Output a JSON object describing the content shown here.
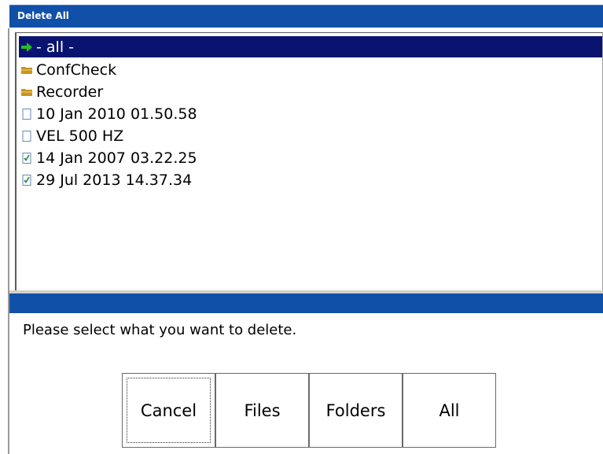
{
  "window": {
    "title": "Delete All"
  },
  "list": {
    "items": [
      {
        "label": "- all -",
        "icon": "green-arrow-icon",
        "selected": true
      },
      {
        "label": "ConfCheck",
        "icon": "folder-icon",
        "selected": false
      },
      {
        "label": "Recorder",
        "icon": "folder-icon",
        "selected": false
      },
      {
        "label": "10 Jan 2010 01.50.58",
        "icon": "file-icon",
        "selected": false
      },
      {
        "label": "VEL 500 HZ",
        "icon": "file-icon",
        "selected": false
      },
      {
        "label": "14 Jan 2007 03.22.25",
        "icon": "checked-file-icon",
        "selected": false
      },
      {
        "label": "29 Jul 2013 14.37.34",
        "icon": "checked-file-icon",
        "selected": false
      }
    ]
  },
  "prompt": "Please select what you want to delete.",
  "buttons": {
    "cancel": "Cancel",
    "files": "Files",
    "folders": "Folders",
    "all": "All"
  },
  "colors": {
    "titlebar": "#1050a8",
    "selection": "#0a1470",
    "folder": "#c8961e",
    "arrow": "#22c022"
  }
}
